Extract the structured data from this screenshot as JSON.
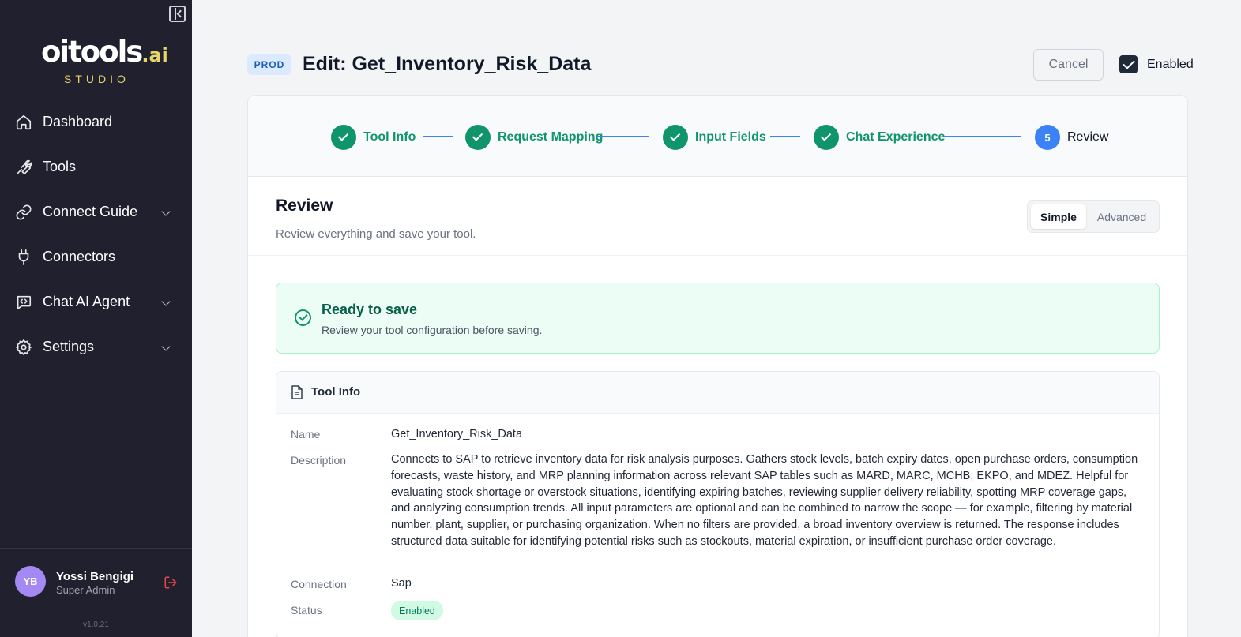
{
  "sidebar": {
    "logo_main": "oitools",
    "logo_ai": ".ai",
    "logo_sub": "STUDIO",
    "items": [
      {
        "label": "Dashboard",
        "icon": "home-icon"
      },
      {
        "label": "Tools",
        "icon": "wrench-icon"
      },
      {
        "label": "Connect Guide",
        "icon": "link-icon",
        "expandable": true
      },
      {
        "label": "Connectors",
        "icon": "plug-icon"
      },
      {
        "label": "Chat AI Agent",
        "icon": "code-chat-icon",
        "expandable": true
      },
      {
        "label": "Settings",
        "icon": "gear-icon",
        "expandable": true
      }
    ],
    "user": {
      "initials": "YB",
      "name": "Yossi Bengigi",
      "role": "Super Admin"
    },
    "version": "v1.0.21"
  },
  "header": {
    "env_badge": "PROD",
    "title": "Edit: Get_Inventory_Risk_Data",
    "cancel_label": "Cancel",
    "enabled_label": "Enabled",
    "enabled": true
  },
  "stepper": {
    "steps": [
      {
        "label": "Tool Info",
        "status": "complete"
      },
      {
        "label": "Request Mapping",
        "status": "complete"
      },
      {
        "label": "Input Fields",
        "status": "complete"
      },
      {
        "label": "Chat Experience",
        "status": "complete"
      },
      {
        "label": "Review",
        "status": "current",
        "number": "5"
      }
    ]
  },
  "review": {
    "title": "Review",
    "subtitle": "Review everything and save your tool.",
    "mode_simple": "Simple",
    "mode_advanced": "Advanced",
    "ready_title": "Ready to save",
    "ready_sub": "Review your tool configuration before saving."
  },
  "tool_info": {
    "section_title": "Tool Info",
    "name_label": "Name",
    "name_value": "Get_Inventory_Risk_Data",
    "description_label": "Description",
    "description_value": "Connects to SAP to retrieve inventory data for risk analysis purposes. Gathers stock levels, batch expiry dates, open purchase orders, consumption forecasts, waste history, and MRP planning information across relevant SAP tables such as MARD, MARC, MCHB, EKPO, and MDEZ. Helpful for evaluating stock shortage or overstock situations, identifying expiring batches, reviewing supplier delivery reliability, spotting MRP coverage gaps, and analyzing consumption trends. All input parameters are optional and can be combined to narrow the scope — for example, filtering by material number, plant, supplier, or purchasing organization. When no filters are provided, a broad inventory overview is returned. The response includes structured data suitable for identifying potential risks such as stockouts, material expiration, or insufficient purchase order coverage.",
    "connection_label": "Connection",
    "connection_value": "Sap",
    "status_label": "Status",
    "status_value": "Enabled"
  },
  "colors": {
    "sidebar_bg": "#21202f",
    "success": "#10956a",
    "accent": "#3b82f6",
    "logo_accent": "#e8d568"
  }
}
